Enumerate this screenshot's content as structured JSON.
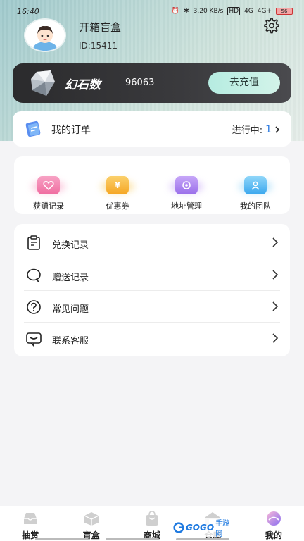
{
  "status_bar": {
    "time": "16:40",
    "speed": "3.20 KB/s",
    "hd": "HD",
    "net1": "4G",
    "net2": "4G+",
    "battery": "56"
  },
  "profile": {
    "name": "开箱盲盒",
    "id": "ID:15411"
  },
  "gem_card": {
    "label": "幻石数",
    "count": "96063",
    "recharge_label": "去充值"
  },
  "orders": {
    "label": "我的订单",
    "status_label": "进行中:",
    "status_count": "1"
  },
  "quick_actions": [
    {
      "label": "获赠记录",
      "icon": "gift-heart-icon",
      "color": "#f06ca0"
    },
    {
      "label": "优惠券",
      "icon": "coupon-icon",
      "color": "#f5b630"
    },
    {
      "label": "地址管理",
      "icon": "location-icon",
      "color": "#a77bf0"
    },
    {
      "label": "我的团队",
      "icon": "team-icon",
      "color": "#3ab4f0"
    }
  ],
  "menu_items": [
    {
      "label": "兑换记录",
      "icon": "clipboard-icon"
    },
    {
      "label": "赠送记录",
      "icon": "chat-bubble-icon"
    },
    {
      "label": "常见问题",
      "icon": "question-icon"
    },
    {
      "label": "联系客服",
      "icon": "message-icon"
    }
  ],
  "tabs": [
    {
      "label": "抽赏",
      "icon": "inbox-icon"
    },
    {
      "label": "盲盒",
      "icon": "box-icon"
    },
    {
      "label": "商城",
      "icon": "bag-icon"
    },
    {
      "label": "仓库",
      "icon": "warehouse-icon"
    },
    {
      "label": "我的",
      "icon": "profile-icon",
      "active": true
    }
  ],
  "watermark": {
    "brand": "GOGO",
    "suffix": "手游网"
  }
}
